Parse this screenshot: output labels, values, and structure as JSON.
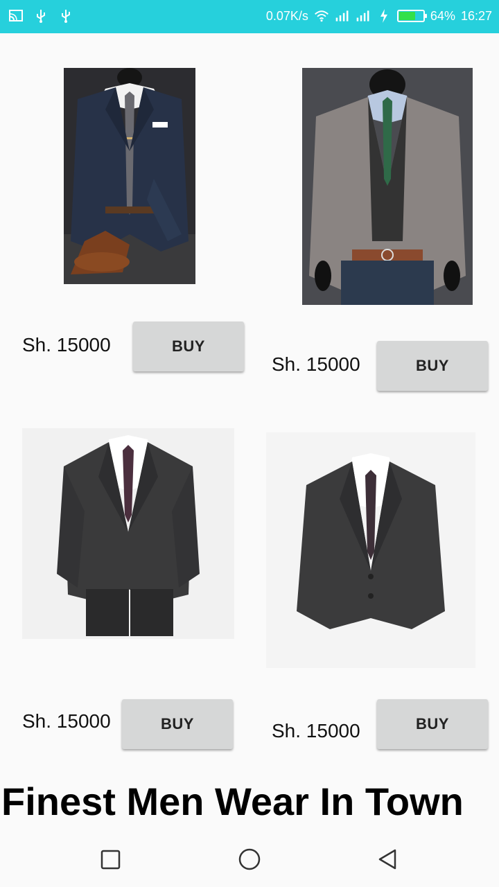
{
  "status_bar": {
    "net_speed": "0.07K/s",
    "battery_level": 0.64,
    "battery_text": "64%",
    "time": "16:27",
    "bg_color": "#26d0dc"
  },
  "products": [
    {
      "price": "Sh. 15000",
      "buy_label": "BUY",
      "image": "navy-suit-with-shoes"
    },
    {
      "price": "Sh. 15000",
      "buy_label": "BUY",
      "image": "grey-tweed-coat-with-vest"
    },
    {
      "price": "Sh. 15000",
      "buy_label": "BUY",
      "image": "charcoal-suit-full"
    },
    {
      "price": "Sh. 15000",
      "buy_label": "BUY",
      "image": "charcoal-suit-jacket"
    }
  ],
  "headline": "Finest Men Wear In Town",
  "nav": {
    "recents_icon": "square-icon",
    "home_icon": "circle-icon",
    "back_icon": "triangle-back-icon"
  }
}
